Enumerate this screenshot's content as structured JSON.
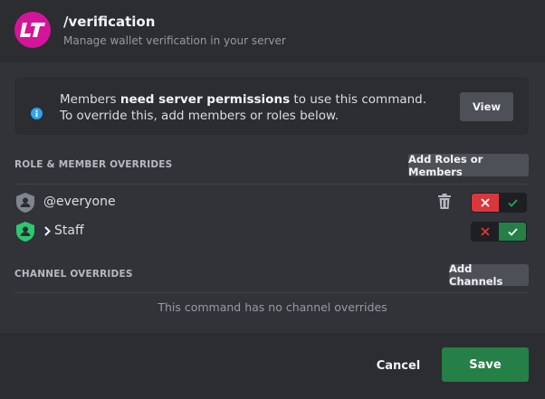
{
  "header": {
    "logo_text": "LT",
    "title": "/verification",
    "subtitle": "Manage wallet verification in your server"
  },
  "notice": {
    "text_before": "Members ",
    "text_bold": "need server permissions",
    "text_after": " to use this command. To override this, add members or roles below.",
    "view_label": "View"
  },
  "role_overrides": {
    "label": "ROLE & MEMBER OVERRIDES",
    "add_label": "Add Roles or Members",
    "rows": [
      {
        "label": "@everyone",
        "denied": true,
        "allowed": false,
        "icon_color": "#80848e"
      },
      {
        "label": "Staff",
        "denied": false,
        "allowed": true,
        "icon_color": "#2dc770"
      }
    ]
  },
  "channel_overrides": {
    "label": "CHANNEL OVERRIDES",
    "add_label": "Add Channels",
    "empty_text": "This command has no channel overrides"
  },
  "footer": {
    "cancel_label": "Cancel",
    "save_label": "Save"
  },
  "colors": {
    "deny_active": "#da373c",
    "allow_active": "#248046",
    "brand": "#d4149a"
  }
}
